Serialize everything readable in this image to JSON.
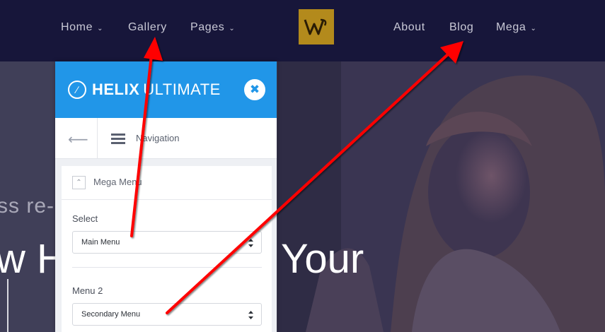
{
  "nav": {
    "left": [
      {
        "label": "Home",
        "has_dropdown": true
      },
      {
        "label": "Gallery",
        "has_dropdown": false
      },
      {
        "label": "Pages",
        "has_dropdown": true
      }
    ],
    "right": [
      {
        "label": "About",
        "has_dropdown": false
      },
      {
        "label": "Blog",
        "has_dropdown": false
      },
      {
        "label": "Mega",
        "has_dropdown": true
      }
    ],
    "logo_letter": "W"
  },
  "hero": {
    "line1": "ss re-",
    "line2": "w H",
    "line2_right": "Your"
  },
  "panel": {
    "brand_bold": "HELIX",
    "brand_light": "ULTIMATE",
    "breadcrumb": "Navigation",
    "section_title": "Mega Menu",
    "fields": [
      {
        "label": "Select",
        "value": "Main Menu"
      },
      {
        "label": "Menu 2",
        "value": "Secondary Menu"
      }
    ]
  },
  "colors": {
    "nav_bg": "#17163a",
    "panel_header": "#2196e8",
    "logo_bg": "#b38a1c",
    "arrow": "#ff0000"
  },
  "icons": [
    "chevron-down-icon",
    "back-arrow-icon",
    "list-icon",
    "close-icon",
    "helix-logo-icon",
    "collapse-icon",
    "select-caret-icon"
  ]
}
